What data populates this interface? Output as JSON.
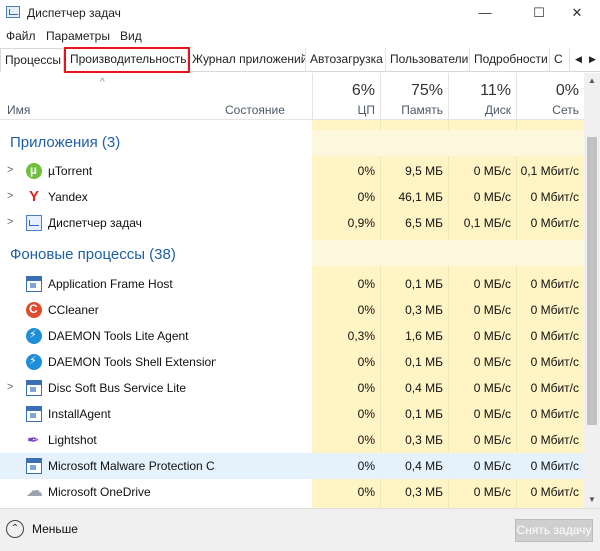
{
  "window": {
    "title": "Диспетчер задач",
    "minimize": "—",
    "maximize": "☐",
    "close": "✕"
  },
  "menu": [
    "Файл",
    "Параметры",
    "Вид"
  ],
  "tabs": [
    {
      "label": "Процессы",
      "active": true
    },
    {
      "label": "Производительность",
      "highlighted": true
    },
    {
      "label": "Журнал приложений"
    },
    {
      "label": "Автозагрузка"
    },
    {
      "label": "Пользователи"
    },
    {
      "label": "Подробности"
    },
    {
      "label": "С"
    }
  ],
  "header": {
    "sort_arrow": "^",
    "name": "Имя",
    "state": "Состояние",
    "cpu": {
      "pct": "6%",
      "label": "ЦП"
    },
    "mem": {
      "pct": "75%",
      "label": "Память"
    },
    "disk": {
      "pct": "11%",
      "label": "Диск"
    },
    "net": {
      "pct": "0%",
      "label": "Сеть"
    }
  },
  "groups": {
    "apps": {
      "title": "Приложения (3)",
      "rows": [
        {
          "name": "µTorrent",
          "icon": "utorrent-icon",
          "expandable": true,
          "cpu": "0%",
          "mem": "9,5 МБ",
          "disk": "0 МБ/с",
          "net": "0,1 Мбит/с"
        },
        {
          "name": "Yandex",
          "icon": "yandex-icon",
          "expandable": true,
          "cpu": "0%",
          "mem": "46,1 МБ",
          "disk": "0 МБ/с",
          "net": "0 Мбит/с"
        },
        {
          "name": "Диспетчер задач",
          "icon": "task-manager-icon",
          "expandable": true,
          "cpu": "0,9%",
          "mem": "6,5 МБ",
          "disk": "0,1 МБ/с",
          "net": "0 Мбит/с"
        }
      ]
    },
    "background": {
      "title": "Фоновые процессы (38)",
      "rows": [
        {
          "name": "Application Frame Host",
          "icon": "window-icon",
          "expandable": false,
          "cpu": "0%",
          "mem": "0,1 МБ",
          "disk": "0 МБ/с",
          "net": "0 Мбит/с"
        },
        {
          "name": "CCleaner",
          "icon": "ccleaner-icon",
          "expandable": false,
          "cpu": "0%",
          "mem": "0,3 МБ",
          "disk": "0 МБ/с",
          "net": "0 Мбит/с"
        },
        {
          "name": "DAEMON Tools Lite Agent",
          "icon": "daemon-tools-icon",
          "expandable": false,
          "cpu": "0,3%",
          "mem": "1,6 МБ",
          "disk": "0 МБ/с",
          "net": "0 Мбит/с"
        },
        {
          "name": "DAEMON Tools Shell Extensions...",
          "icon": "daemon-tools-icon",
          "expandable": false,
          "cpu": "0%",
          "mem": "0,1 МБ",
          "disk": "0 МБ/с",
          "net": "0 Мбит/с"
        },
        {
          "name": "Disc Soft Bus Service Lite",
          "icon": "window-icon",
          "expandable": true,
          "cpu": "0%",
          "mem": "0,4 МБ",
          "disk": "0 МБ/с",
          "net": "0 Мбит/с"
        },
        {
          "name": "InstallAgent",
          "icon": "window-icon",
          "expandable": false,
          "cpu": "0%",
          "mem": "0,1 МБ",
          "disk": "0 МБ/с",
          "net": "0 Мбит/с"
        },
        {
          "name": "Lightshot",
          "icon": "lightshot-icon",
          "expandable": false,
          "cpu": "0%",
          "mem": "0,3 МБ",
          "disk": "0 МБ/с",
          "net": "0 Мбит/с"
        },
        {
          "name": "Microsoft Malware Protection C...",
          "icon": "window-icon",
          "expandable": false,
          "selected": true,
          "cpu": "0%",
          "mem": "0,4 МБ",
          "disk": "0 МБ/с",
          "net": "0 Мбит/с"
        },
        {
          "name": "Microsoft OneDrive",
          "icon": "onedrive-icon",
          "expandable": false,
          "cpu": "0%",
          "mem": "0,3 МБ",
          "disk": "0 МБ/с",
          "net": "0 Мбит/с"
        }
      ]
    }
  },
  "footer": {
    "less_label": "Меньше",
    "less_icon": "⌃",
    "end_task": "Снять задачу"
  },
  "colors": {
    "usage_fill": "#fff4c4",
    "group_title": "#1f5fa8",
    "tab_highlight": "#e8121f",
    "selected_row": "#e5f1fb"
  }
}
